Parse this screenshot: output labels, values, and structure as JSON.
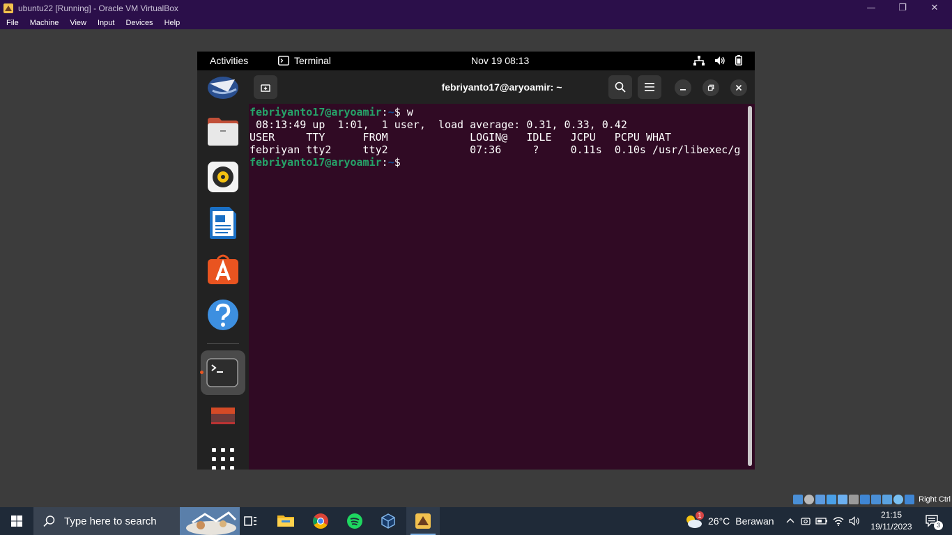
{
  "vbox": {
    "title": "ubuntu22 [Running] - Oracle VM VirtualBox",
    "menu": [
      "File",
      "Machine",
      "View",
      "Input",
      "Devices",
      "Help"
    ],
    "window_controls": {
      "minimize": "—",
      "maximize": "❐",
      "close": "✕"
    },
    "host_key": "Right Ctrl"
  },
  "gnome": {
    "activities": "Activities",
    "app_menu": "Terminal",
    "clock": "Nov 19  08:13"
  },
  "terminal": {
    "title": "febriyanto17@aryoamir: ~",
    "prompt_user": "febriyanto17@aryoamir",
    "prompt_sep": ":",
    "prompt_path": "~",
    "prompt_sign": "$",
    "command": " w",
    "output": [
      " 08:13:49 up  1:01,  1 user,  load average: 0.31, 0.33, 0.42",
      "USER     TTY      FROM             LOGIN@   IDLE   JCPU   PCPU WHAT",
      "febriyan tty2     tty2             07:36     ?     0.11s  0.10s /usr/libexec/g"
    ],
    "colors": {
      "bg": "#300a24",
      "user": "#26a269",
      "path": "#12488b"
    }
  },
  "taskbar": {
    "search_placeholder": "Type here to search",
    "weather": {
      "temp": "26°C",
      "desc": "Berawan",
      "badge": "1"
    },
    "time": "21:15",
    "date": "19/11/2023",
    "notification_count": "3"
  }
}
